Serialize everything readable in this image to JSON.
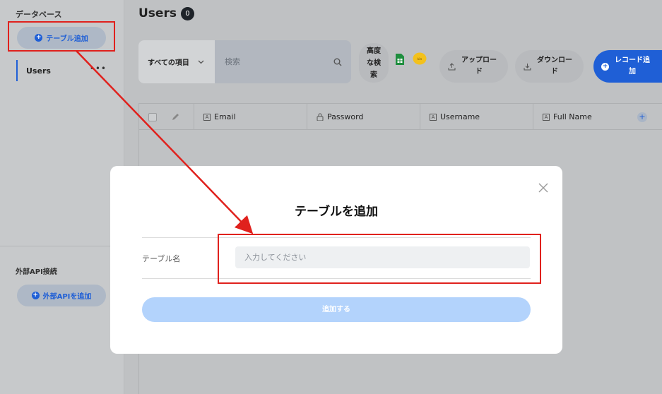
{
  "sidebar": {
    "section_title": "データベース",
    "add_table_label": "テーブル追加",
    "tables": [
      {
        "name": "Users"
      }
    ],
    "more_label": "•••",
    "api_section_title": "外部API接続",
    "add_api_label": "外部APIを追加"
  },
  "header": {
    "title": "Users",
    "count": "0"
  },
  "toolbar": {
    "filter_selected": "すべての項目",
    "search_placeholder": "検索",
    "advanced_search_label": "高度な検索",
    "advanced_search_line1": "高度",
    "advanced_search_line2": "な検",
    "advanced_search_line3": "索",
    "upload_line1": "アップロー",
    "upload_line2": "ド",
    "download_line1": "ダウンロー",
    "download_line2": "ド",
    "add_record_line1": "レコード追",
    "add_record_line2": "加",
    "sheets_icon": "google-sheets-icon",
    "kintone_icon": "kintone-icon"
  },
  "table": {
    "columns": [
      {
        "name": "Email",
        "type": "text"
      },
      {
        "name": "Password",
        "type": "lock"
      },
      {
        "name": "Username",
        "type": "text"
      },
      {
        "name": "Full Name",
        "type": "text"
      }
    ],
    "type_glyph": "A",
    "add_column_glyph": "+"
  },
  "modal": {
    "title": "テーブルを追加",
    "field_label": "テーブル名",
    "input_placeholder": "入力してください",
    "input_value": "",
    "submit_label": "追加する"
  },
  "colors": {
    "accent": "#1f5fd6",
    "annotation_red": "#e0211d",
    "submit_disabled": "#b3d3fc"
  }
}
